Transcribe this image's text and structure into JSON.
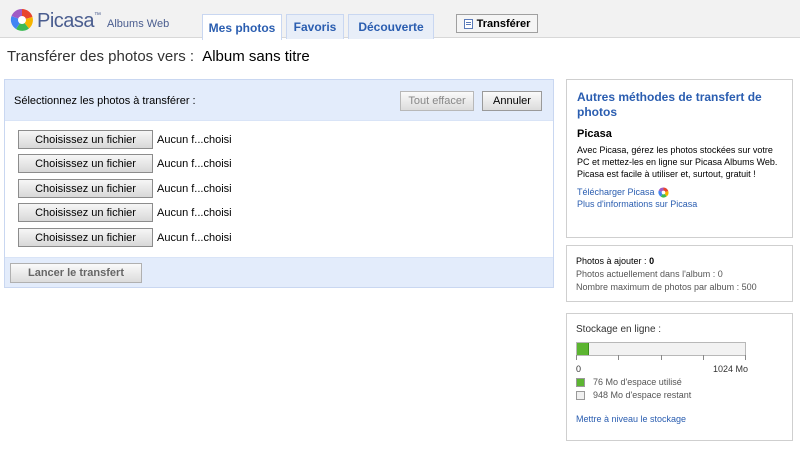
{
  "header": {
    "logo_text": "Picasa",
    "logo_tm": "™",
    "logo_sub": "Albums Web",
    "tabs": [
      {
        "label": "Mes photos",
        "active": true
      },
      {
        "label": "Favoris",
        "active": false
      },
      {
        "label": "Découverte",
        "active": false
      }
    ],
    "upload_button": "Transférer",
    "upload_icon": "upload-page-icon"
  },
  "page": {
    "title_prefix": "Transférer des photos vers :",
    "album_name": "Album sans titre"
  },
  "upload_panel": {
    "select_label": "Sélectionnez les photos à transférer :",
    "clear_button": "Tout effacer",
    "cancel_button": "Annuler",
    "file_rows": [
      {
        "button": "Choisissez un fichier",
        "status": "Aucun f...choisi"
      },
      {
        "button": "Choisissez un fichier",
        "status": "Aucun f...choisi"
      },
      {
        "button": "Choisissez un fichier",
        "status": "Aucun f...choisi"
      },
      {
        "button": "Choisissez un fichier",
        "status": "Aucun f...choisi"
      },
      {
        "button": "Choisissez un fichier",
        "status": "Aucun f...choisi"
      }
    ],
    "launch_button": "Lancer le transfert"
  },
  "sidebar": {
    "methods": {
      "title": "Autres méthodes de transfert de photos",
      "subtitle": "Picasa",
      "text": "Avec Picasa, gérez les photos stockées sur votre PC et mettez-les en ligne sur Picasa Albums Web. Picasa est facile à utiliser et, surtout, gratuit !",
      "download_link": "Télécharger Picasa",
      "info_link": "Plus d'informations sur Picasa"
    },
    "counts": {
      "to_add_label": "Photos à ajouter :",
      "to_add_value": "0",
      "in_album": "Photos actuellement dans l'album : 0",
      "max": "Nombre maximum de photos par album : 500"
    },
    "storage": {
      "label": "Stockage en ligne :",
      "used_mb": 76,
      "total_mb": 1024,
      "scale_min": "0",
      "scale_max": "1024 Mo",
      "used_text": "76 Mo d'espace utilisé",
      "free_text": "948 Mo d'espace restant",
      "used_color": "#5cb531",
      "free_color": "#f0f0f0",
      "upgrade_link": "Mettre à niveau le stockage"
    }
  }
}
